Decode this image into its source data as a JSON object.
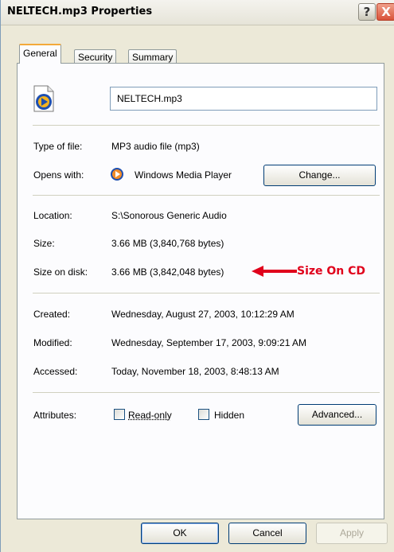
{
  "window": {
    "title": "NELTECH.mp3 Properties",
    "help_label": "?",
    "close_label": "X"
  },
  "tabs": [
    {
      "label": "General",
      "active": true
    },
    {
      "label": "Security",
      "active": false
    },
    {
      "label": "Summary",
      "active": false
    }
  ],
  "file": {
    "icon": "media-file-icon",
    "name": "NELTECH.mp3"
  },
  "fields": {
    "type_label": "Type of file:",
    "type_value": "MP3 audio file (mp3)",
    "opens_label": "Opens with:",
    "opens_value": "Windows Media Player",
    "opens_icon": "windows-media-player-icon",
    "change_button": "Change...",
    "location_label": "Location:",
    "location_value": "S:\\Sonorous Generic Audio",
    "size_label": "Size:",
    "size_value": "3.66 MB (3,840,768 bytes)",
    "size_on_disk_label": "Size on disk:",
    "size_on_disk_value": "3.66 MB (3,842,048 bytes)",
    "created_label": "Created:",
    "created_value": "Wednesday, August 27, 2003, 10:12:29 AM",
    "modified_label": "Modified:",
    "modified_value": "Wednesday, September 17, 2003, 9:09:21 AM",
    "accessed_label": "Accessed:",
    "accessed_value": "Today, November 18, 2003, 8:48:13 AM",
    "attributes_label": "Attributes:",
    "readonly_label": "Read-only",
    "readonly_checked": false,
    "hidden_label": "Hidden",
    "hidden_checked": false,
    "advanced_button": "Advanced..."
  },
  "annotation": {
    "text": "Size On CD",
    "color": "#e0001b"
  },
  "footer": {
    "ok": "OK",
    "cancel": "Cancel",
    "apply": "Apply"
  },
  "colors": {
    "window_bg": "#ece9d8",
    "panel_bg": "#fcfcfe",
    "active_tab_accent": "#f3a93a",
    "close_button": "#d9533a"
  }
}
